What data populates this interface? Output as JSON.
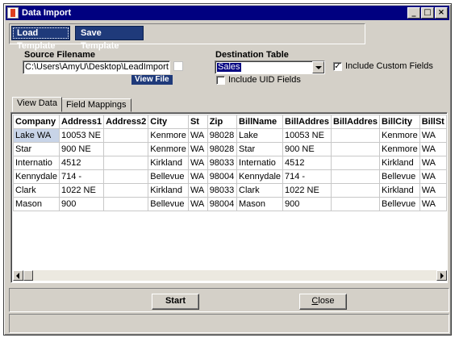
{
  "window": {
    "title": "Data Import",
    "controls": [
      "_",
      "□",
      "×"
    ]
  },
  "toolbar": {
    "load_label": "Load Template",
    "save_label": "Save Template"
  },
  "source": {
    "label": "Source Filename",
    "value": "C:\\Users\\AmyU\\Desktop\\LeadImport.xlsx",
    "view_file_label": "View File"
  },
  "destination": {
    "label": "Destination Table",
    "selected": "Sales"
  },
  "options": {
    "include_custom_fields": {
      "label": "Include Custom Fields",
      "checked": true
    },
    "include_uid_fields": {
      "label": "Include UID Fields",
      "checked": false
    }
  },
  "tabs": [
    {
      "label": "View Data",
      "active": true
    },
    {
      "label": "Field Mappings",
      "active": false
    }
  ],
  "grid": {
    "columns": [
      "Company",
      "Address1",
      "Address2",
      "City",
      "St",
      "Zip",
      "BillName",
      "BillAddres",
      "BillAddres",
      "BillCity",
      "BillSt"
    ],
    "rows": [
      [
        "Lake WA",
        "10053 NE",
        "",
        "Kenmore",
        "WA",
        "98028",
        "Lake",
        "10053 NE",
        "",
        "Kenmore",
        "WA"
      ],
      [
        "Star",
        "900 NE",
        "",
        "Kenmore",
        "WA",
        "98028",
        "Star",
        "900 NE",
        "",
        "Kenmore",
        "WA"
      ],
      [
        "Internatio",
        "4512",
        "",
        "Kirkland",
        "WA",
        "98033",
        "Internatio",
        "4512",
        "",
        "Kirkland",
        "WA"
      ],
      [
        "Kennydale",
        "714 -",
        "",
        "Bellevue",
        "WA",
        "98004",
        "Kennydale",
        "714 -",
        "",
        "Bellevue",
        "WA"
      ],
      [
        "Clark",
        "1022 NE",
        "",
        "Kirkland",
        "WA",
        "98033",
        "Clark",
        "1022 NE",
        "",
        "Kirkland",
        "WA"
      ],
      [
        "Mason",
        "900",
        "",
        "Bellevue",
        "WA",
        "98004",
        "Mason",
        "900",
        "",
        "Bellevue",
        "WA"
      ]
    ]
  },
  "buttons": {
    "start": "Start",
    "close_underlined": "C",
    "close_rest": "lose"
  }
}
